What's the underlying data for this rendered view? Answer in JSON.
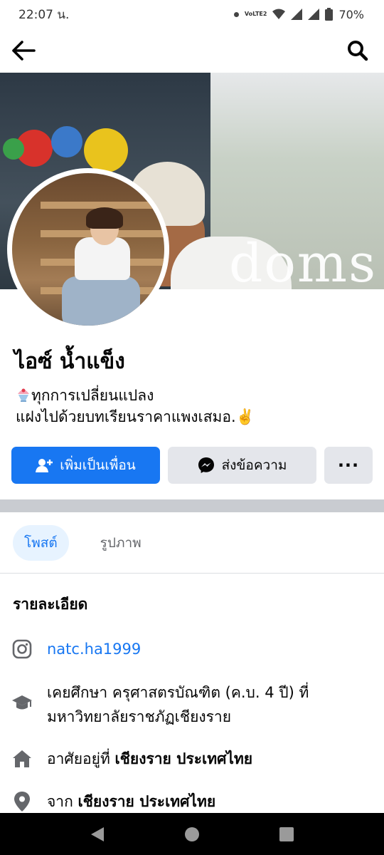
{
  "status_bar": {
    "time": "22:07 น.",
    "network_label": "VoLTE2",
    "battery": "70%"
  },
  "app_bar": {
    "back_icon": "arrow-left-icon",
    "search_icon": "search-icon"
  },
  "cover": {
    "sign_text": "doms"
  },
  "profile": {
    "name": "ไอซ์ น้ำแข็ง",
    "bio_line1": "ทุกการเปลี่ยนแปลง",
    "bio_line2": "แฝงไปด้วยบทเรียนราคาแพงเสมอ.✌️",
    "bio_emoji": "shaved-ice-emoji"
  },
  "actions": {
    "add_friend": "เพิ่มเป็นเพื่อน",
    "message": "ส่งข้อความ",
    "more": "···"
  },
  "tabs": [
    {
      "label": "โพสต์",
      "active": true
    },
    {
      "label": "รูปภาพ",
      "active": false
    }
  ],
  "details": {
    "title": "รายละเอียด",
    "instagram": "natc.ha1999",
    "education_line1": "เคยศึกษา ครุศาสตรบัณฑิต (ค.บ. 4 ปี) ที่",
    "education_line2": "มหาวิทยาลัยราชภัฏเชียงราย",
    "lives_prefix": "อาศัยอยู่ที่ ",
    "lives_place": "เชียงราย ประเทศไทย",
    "from_prefix": "จาก ",
    "from_place": "เชียงราย ประเทศไทย"
  },
  "colors": {
    "primary": "#1877f2",
    "secondary_button": "#e4e6eb",
    "divider": "#c9ccd1",
    "tab_active_bg": "#e7f3ff"
  }
}
